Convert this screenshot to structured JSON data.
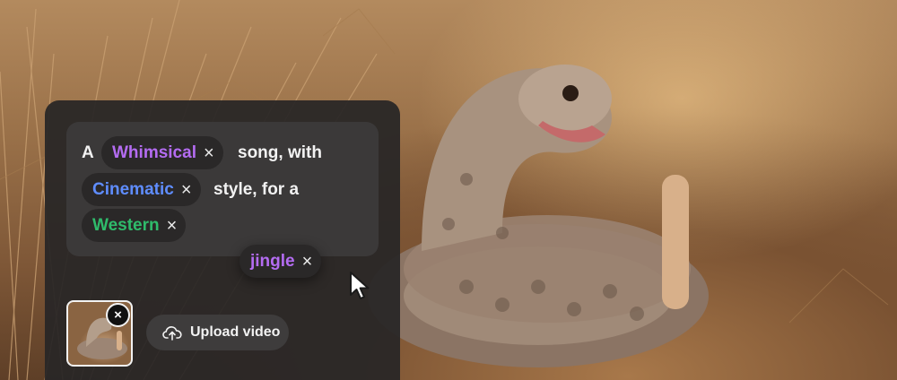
{
  "prompt": {
    "w_a": "A",
    "chip_whimsical": "Whimsical",
    "w_song_with": "song, with",
    "chip_cinematic": "Cinematic",
    "w_style_for_a": "style, for a",
    "chip_western": "Western",
    "chip_jingle": "jingle",
    "remove_glyph": "×"
  },
  "media": {
    "remove_glyph": "×",
    "upload_label": "Upload video"
  },
  "colors": {
    "whimsical": "#b46cf2",
    "cinematic": "#5f8dff",
    "western": "#2fbb6b",
    "jingle": "#b46cf2"
  },
  "icons": [
    "x-icon",
    "cursor-icon",
    "cloud-upload-icon"
  ]
}
